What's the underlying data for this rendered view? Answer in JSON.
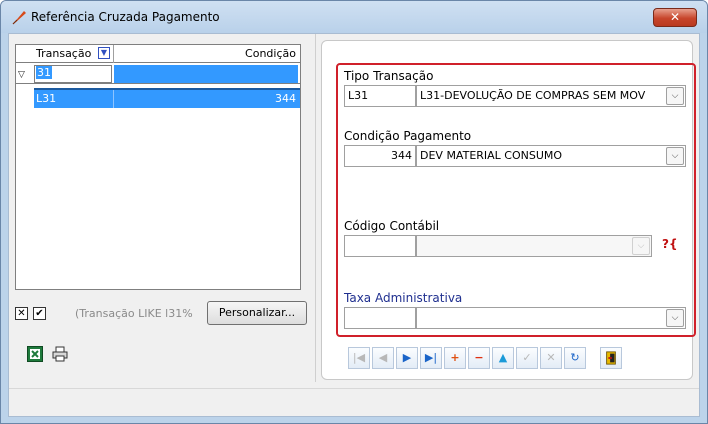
{
  "window": {
    "title": "Referência Cruzada Pagamento",
    "close_glyph": "✕",
    "icon": "red-feather-icon"
  },
  "grid": {
    "columns": [
      "Transação",
      "Condição"
    ],
    "filter_value": "31",
    "rows": [
      {
        "transacao": "L31",
        "condicao": "344"
      }
    ]
  },
  "filter_bar": {
    "clear_glyph": "✕",
    "enabled_glyph": "✔",
    "filter_text": "(Transação LIKE l31%",
    "customize_label": "Personalizar..."
  },
  "left_icons": [
    "excel-icon",
    "print-icon"
  ],
  "form": {
    "tipo_transacao": {
      "label": "Tipo Transação",
      "code": "L31",
      "description": "L31-DEVOLUÇÃO DE COMPRAS SEM MOV"
    },
    "condicao_pagamento": {
      "label": "Condição Pagamento",
      "code": "344",
      "description": "DEV MATERIAL CONSUMO"
    },
    "codigo_contabil": {
      "label": "Código Contábil",
      "code": "",
      "description": "",
      "help_glyph": "?{"
    },
    "taxa_administrativa": {
      "label": "Taxa Administrativa",
      "code": "",
      "description": ""
    }
  },
  "navigator": [
    {
      "name": "first",
      "glyph": "|◀",
      "enabled": false
    },
    {
      "name": "prior",
      "glyph": "◀",
      "enabled": false
    },
    {
      "name": "next",
      "glyph": "▶",
      "enabled": true
    },
    {
      "name": "last",
      "glyph": "▶|",
      "enabled": true
    },
    {
      "name": "insert",
      "glyph": "+",
      "enabled": true
    },
    {
      "name": "delete",
      "glyph": "−",
      "enabled": true
    },
    {
      "name": "edit",
      "glyph": "▲",
      "enabled": true
    },
    {
      "name": "post",
      "glyph": "✓",
      "enabled": false
    },
    {
      "name": "cancel",
      "glyph": "✕",
      "enabled": false
    },
    {
      "name": "refresh",
      "glyph": "↻",
      "enabled": true
    }
  ],
  "colors": {
    "selection": "#3399ff",
    "highlight_frame": "#d0202a",
    "label_blue": "#1f2f8f"
  }
}
